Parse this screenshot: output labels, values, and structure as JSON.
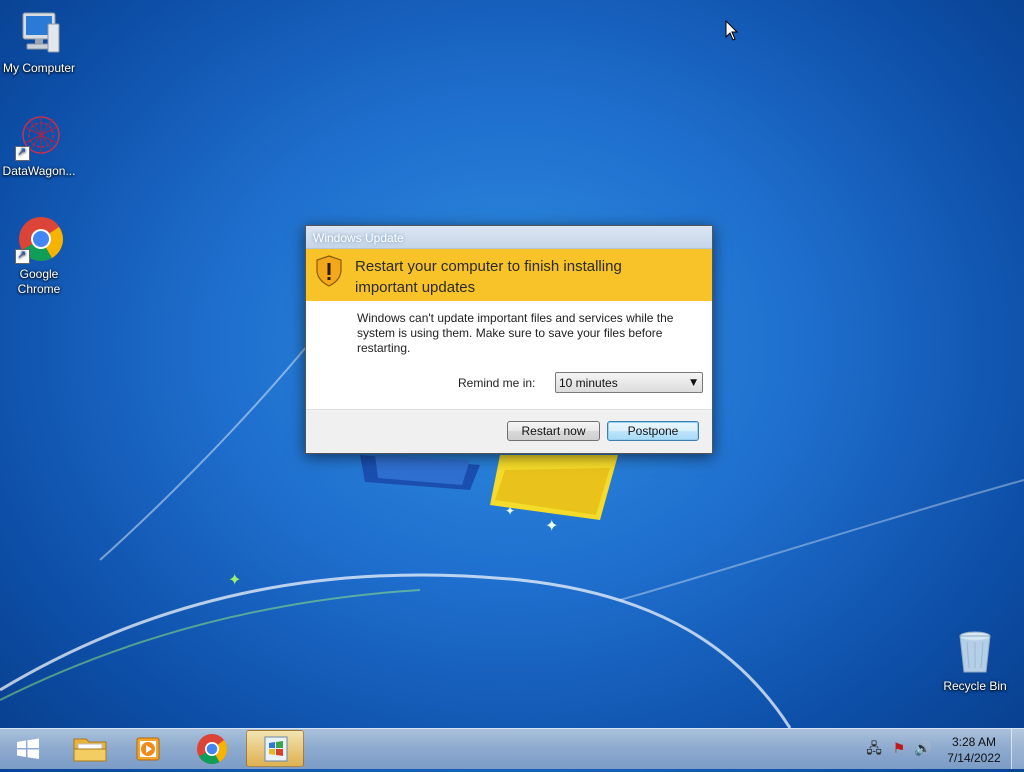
{
  "desktop": {
    "icons": [
      {
        "label": "My Computer",
        "icon": "computer-icon"
      },
      {
        "label": "DataWagon...",
        "icon": "datawagon-icon"
      },
      {
        "label_line1": "Google",
        "label_line2": "Chrome",
        "icon": "chrome-icon"
      },
      {
        "label": "Recycle Bin",
        "icon": "recycle-bin-icon"
      }
    ]
  },
  "dialog": {
    "title": "Windows Update",
    "heading_line1": "Restart your computer to finish installing",
    "heading_line2": "important updates",
    "body_line1": "Windows can't update important files and services while the",
    "body_line2": "system is using them. Make sure to save your files before",
    "body_line3": "restarting.",
    "remind_label": "Remind me in:",
    "remind_value": "10 minutes",
    "restart_label": "Restart now",
    "postpone_label": "Postpone",
    "banner_color": "#f8c328"
  },
  "taskbar": {
    "items": [
      "start-orb-icon",
      "file-explorer-icon",
      "media-player-icon",
      "chrome-icon",
      "windows-update-icon"
    ],
    "tray_icons": [
      "network-icon",
      "action-center-flag-icon",
      "volume-icon"
    ],
    "time": "3:28 AM",
    "date": "7/14/2022"
  }
}
